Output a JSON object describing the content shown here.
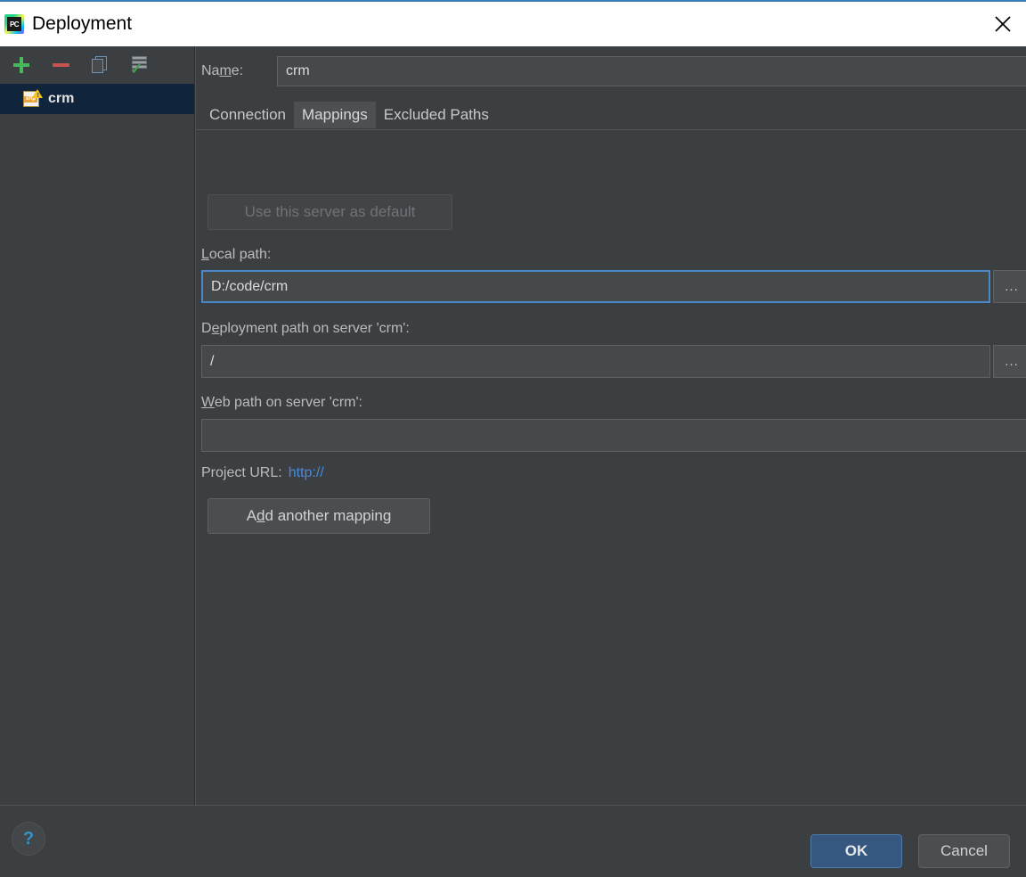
{
  "window": {
    "title": "Deployment",
    "app_icon": "pycharm-logo-icon",
    "close_icon": "close-icon"
  },
  "sidebar": {
    "toolbar": [
      {
        "name": "add-server-button",
        "icon": "plus-icon",
        "label": ""
      },
      {
        "name": "remove-server-button",
        "icon": "minus-icon",
        "label": ""
      },
      {
        "name": "copy-server-button",
        "icon": "copy-icon",
        "label": ""
      },
      {
        "name": "set-default-server-button",
        "icon": "server-check-icon",
        "label": ""
      }
    ],
    "servers": [
      {
        "label": "crm",
        "icon": "sftp-icon",
        "selected": true
      }
    ]
  },
  "form": {
    "name_label": "Na",
    "name_label_mnemonic": "m",
    "name_label_rest": "e:",
    "name_value": "crm",
    "name_placeholder": ""
  },
  "tabs": [
    {
      "label": "Connection",
      "active": false
    },
    {
      "label": "Mappings",
      "active": true
    },
    {
      "label": "Excluded Paths",
      "active": false
    }
  ],
  "mappings": {
    "use_default_button": "Use this server as default",
    "use_default_disabled": true,
    "local_path": {
      "label_pre": "",
      "label_mnemonic": "L",
      "label_post": "ocal path:",
      "value": "D:/code/crm",
      "placeholder": "",
      "focused": true,
      "browse_label": "..."
    },
    "deployment_path": {
      "label_pre": "D",
      "label_mnemonic": "e",
      "label_post": "ployment path on server 'crm':",
      "value": "/",
      "placeholder": "",
      "focused": false,
      "browse_label": "..."
    },
    "web_path": {
      "label_pre": "",
      "label_mnemonic": "W",
      "label_post": "eb path on server 'crm':",
      "value": "",
      "placeholder": "",
      "focused": false
    },
    "project_url_label": "Project URL:",
    "project_url_value": "http://",
    "add_mapping_pre": "A",
    "add_mapping_mnemonic": "d",
    "add_mapping_post": "d another mapping"
  },
  "footer": {
    "help_label": "?",
    "ok_label": "OK",
    "cancel_label": "Cancel"
  },
  "colors": {
    "accent_blue": "#365880",
    "link_blue": "#4a88d8",
    "focus_border": "#4a88c7",
    "panel_bg": "#3c3f41",
    "field_bg": "#45494a",
    "selection_bg": "#10243b",
    "titlebar_bg": "#ffffff",
    "titlebar_accent": "#3a7fb8"
  }
}
